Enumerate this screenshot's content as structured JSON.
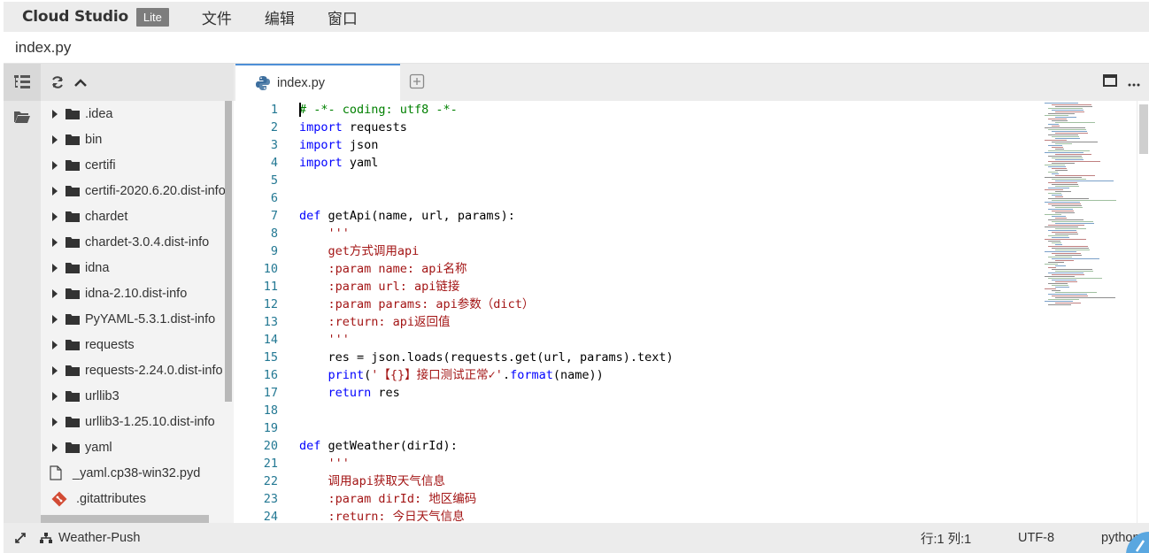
{
  "menubar": {
    "brand": "Cloud Studio",
    "badge": "Lite",
    "items": [
      "文件",
      "编辑",
      "窗口"
    ]
  },
  "file_title": "index.py",
  "explorer": {
    "items": [
      {
        "label": ".idea",
        "type": "folder"
      },
      {
        "label": "bin",
        "type": "folder"
      },
      {
        "label": "certifi",
        "type": "folder"
      },
      {
        "label": "certifi-2020.6.20.dist-info",
        "type": "folder"
      },
      {
        "label": "chardet",
        "type": "folder"
      },
      {
        "label": "chardet-3.0.4.dist-info",
        "type": "folder"
      },
      {
        "label": "idna",
        "type": "folder"
      },
      {
        "label": "idna-2.10.dist-info",
        "type": "folder"
      },
      {
        "label": "PyYAML-5.3.1.dist-info",
        "type": "folder"
      },
      {
        "label": "requests",
        "type": "folder"
      },
      {
        "label": "requests-2.24.0.dist-info",
        "type": "folder"
      },
      {
        "label": "urllib3",
        "type": "folder"
      },
      {
        "label": "urllib3-1.25.10.dist-info",
        "type": "folder"
      },
      {
        "label": "yaml",
        "type": "folder"
      },
      {
        "label": "_yaml.cp38-win32.pyd",
        "type": "file"
      },
      {
        "label": ".gitattributes",
        "type": "git"
      }
    ]
  },
  "tabs": [
    {
      "label": "index.py",
      "icon": "python-icon",
      "active": true
    }
  ],
  "editor": {
    "line_numbers": [
      "1",
      "2",
      "3",
      "4",
      "5",
      "6",
      "7",
      "8",
      "9",
      "10",
      "11",
      "12",
      "13",
      "14",
      "15",
      "16",
      "17",
      "18",
      "19",
      "20",
      "21",
      "22",
      "23",
      "24"
    ],
    "lines": [
      [
        {
          "t": "# -*- coding: utf8 -*-",
          "c": "cm"
        }
      ],
      [
        {
          "t": "import",
          "c": "kw"
        },
        {
          "t": " requests",
          "c": ""
        }
      ],
      [
        {
          "t": "import",
          "c": "kw"
        },
        {
          "t": " json",
          "c": ""
        }
      ],
      [
        {
          "t": "import",
          "c": "kw"
        },
        {
          "t": " yaml",
          "c": ""
        }
      ],
      [],
      [],
      [
        {
          "t": "def",
          "c": "kw"
        },
        {
          "t": " getApi(name, url, params):",
          "c": ""
        }
      ],
      [
        {
          "t": "    '''",
          "c": "st"
        }
      ],
      [
        {
          "t": "    get方式调用api",
          "c": "st"
        }
      ],
      [
        {
          "t": "    :param name: api名称",
          "c": "st"
        }
      ],
      [
        {
          "t": "    :param url: api链接",
          "c": "st"
        }
      ],
      [
        {
          "t": "    :param params: api参数（dict）",
          "c": "st"
        }
      ],
      [
        {
          "t": "    :return: api返回值",
          "c": "st"
        }
      ],
      [
        {
          "t": "    '''",
          "c": "st"
        }
      ],
      [
        {
          "t": "    res = json.loads(requests.get(url, params).text)",
          "c": ""
        }
      ],
      [
        {
          "t": "    ",
          "c": ""
        },
        {
          "t": "print",
          "c": "kw"
        },
        {
          "t": "(",
          "c": ""
        },
        {
          "t": "'【{}】接口测试正常✓'",
          "c": "st"
        },
        {
          "t": ".",
          "c": ""
        },
        {
          "t": "format",
          "c": "kw"
        },
        {
          "t": "(name))",
          "c": ""
        }
      ],
      [
        {
          "t": "    ",
          "c": ""
        },
        {
          "t": "return",
          "c": "kw"
        },
        {
          "t": " res",
          "c": ""
        }
      ],
      [],
      [],
      [
        {
          "t": "def",
          "c": "kw"
        },
        {
          "t": " getWeather(dirId):",
          "c": ""
        }
      ],
      [
        {
          "t": "    '''",
          "c": "st"
        }
      ],
      [
        {
          "t": "    调用api获取天气信息",
          "c": "st"
        }
      ],
      [
        {
          "t": "    :param dirId: 地区编码",
          "c": "st"
        }
      ],
      [
        {
          "t": "    :return: 今日天气信息",
          "c": "st"
        }
      ]
    ]
  },
  "statusbar": {
    "project": "Weather-Push",
    "position": "行:1 列:1",
    "encoding": "UTF-8",
    "language": "python"
  },
  "colors": {
    "keyword": "#0000ff",
    "comment": "#008000",
    "string": "#a31515",
    "line_number": "#237893",
    "tab_accent": "#4d8fd6"
  }
}
